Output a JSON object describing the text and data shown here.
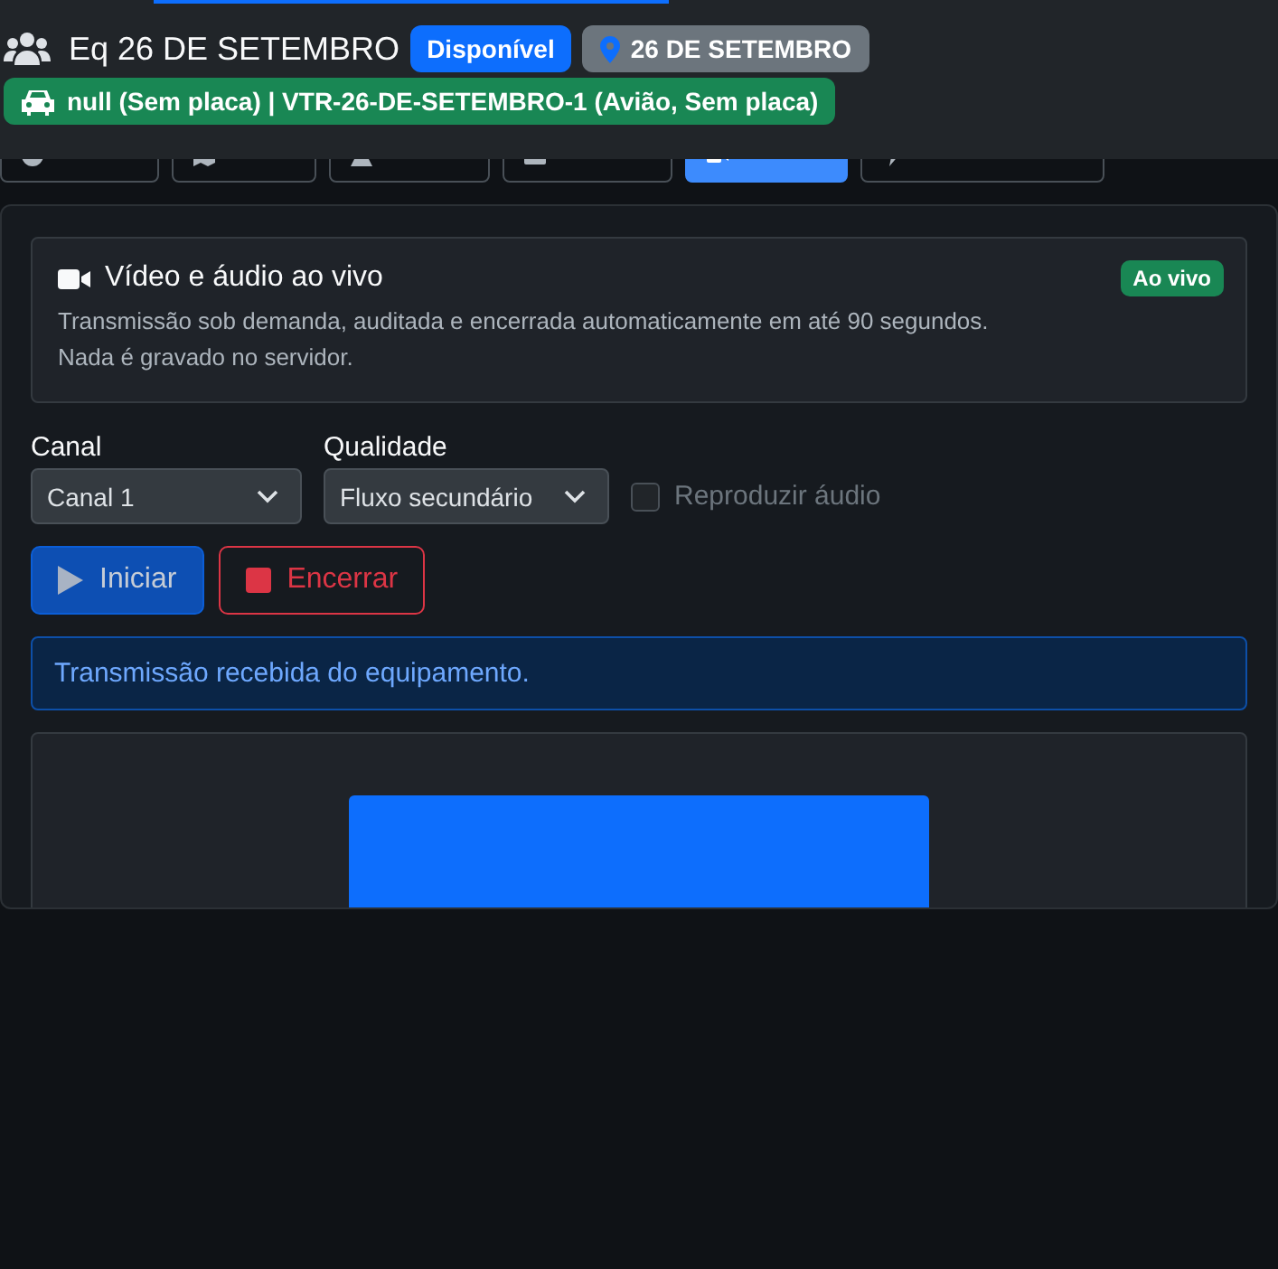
{
  "header": {
    "title": "Eq 26 DE SETEMBRO",
    "status": "Disponível",
    "location": "26 DE SETEMBRO",
    "vehicle": "null (Sem placa) | VTR-26-DE-SETEMBRO-1 (Avião, Sem placa)"
  },
  "tabs": [
    {
      "selected": false
    },
    {
      "selected": false
    },
    {
      "selected": false
    },
    {
      "selected": false
    },
    {
      "selected": true
    },
    {
      "selected": false
    }
  ],
  "live_card": {
    "title": "Vídeo e áudio ao vivo",
    "badge": "Ao vivo",
    "description": [
      "Transmissão sob demanda, auditada e encerrada automaticamente em até 90 segundos.",
      "Nada é gravado no servidor."
    ]
  },
  "channel": {
    "label": "Canal",
    "value": "Canal 1"
  },
  "quality": {
    "label": "Qualidade",
    "value": "Fluxo secundário"
  },
  "audio": {
    "label": "Reproduzir áudio",
    "checked": false
  },
  "buttons": [
    {
      "label": "Iniciar",
      "kind": "primary",
      "disabled": true
    },
    {
      "label": "Encerrar",
      "kind": "danger",
      "disabled": false
    }
  ],
  "alert": "Transmissão recebida do equipamento."
}
